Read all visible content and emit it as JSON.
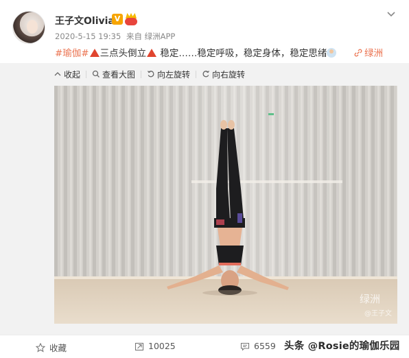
{
  "post": {
    "username": "王子文Olivia",
    "verified_badge": "V",
    "timestamp": "2020-5-15 19:35",
    "source": "来自 绿洲APP",
    "text": {
      "topic": "#瑜伽#",
      "segment_1": "三点头倒立",
      "segment_2": " 稳定……稳定呼吸，稳定身体，稳定思绪"
    },
    "location": "绿洲"
  },
  "toolbar": {
    "collapse_label": "收起",
    "view_large_label": "查看大图",
    "rotate_left_label": "向左旋转",
    "rotate_right_label": "向右旋转"
  },
  "photo": {
    "watermark_app": "绿洲",
    "watermark_user": "@王子文"
  },
  "footer": {
    "favorite_label": "收藏",
    "repost_count": "10025",
    "comment_count": "6559"
  },
  "overlay": {
    "source_watermark": "头条 @Rosie的瑜伽乐园"
  },
  "icons": {
    "more": "chevron-down-icon",
    "collapse": "collapse-icon",
    "view_large": "magnifier-icon",
    "rotate_left": "rotate-left-icon",
    "rotate_right": "rotate-right-icon",
    "favorite": "star-icon",
    "repost": "repost-icon",
    "comment": "comment-icon",
    "location": "location-link-icon"
  },
  "colors": {
    "accent": "#eb7350",
    "triangle": "#e0452f",
    "vip": "#f7a500"
  }
}
